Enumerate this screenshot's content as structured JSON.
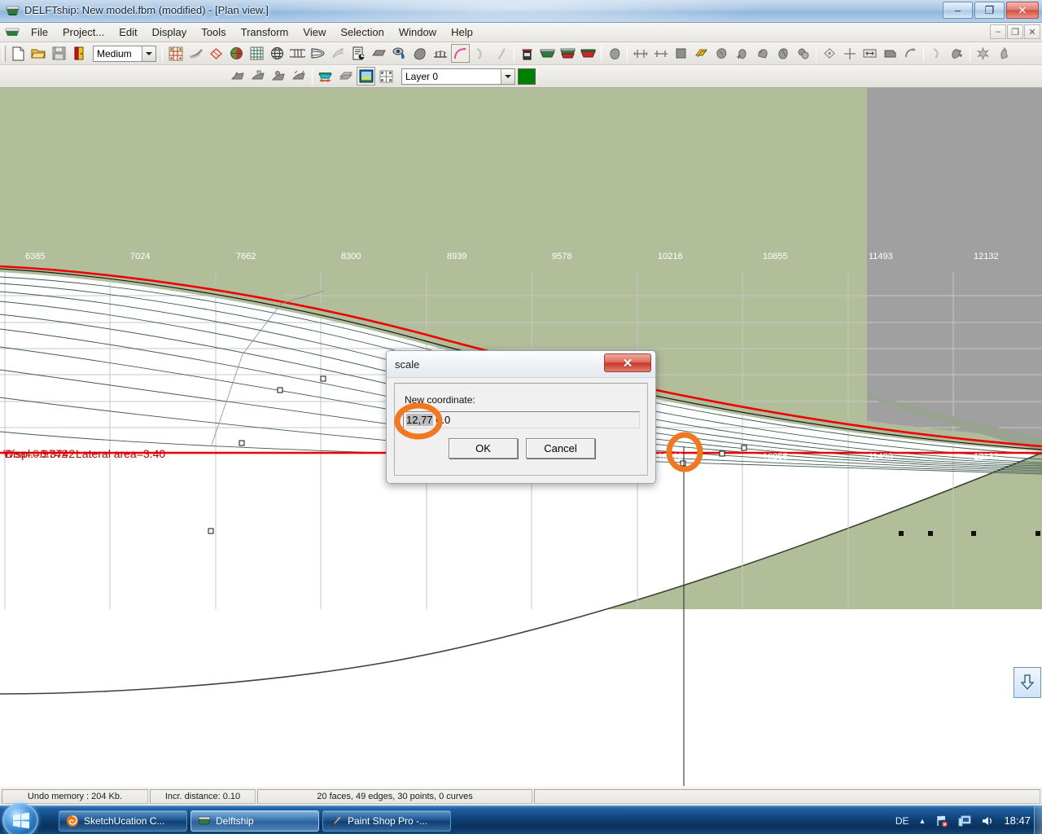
{
  "window": {
    "title": "DELFTship: New model.fbm (modified) - [Plan view.]",
    "minimize": "–",
    "restore": "❐",
    "close": "✕"
  },
  "mdi": {
    "minimize": "–",
    "restore": "❐",
    "close": "✕"
  },
  "menu": {
    "items": [
      {
        "label": "File"
      },
      {
        "label": "Project..."
      },
      {
        "label": "Edit"
      },
      {
        "label": "Display"
      },
      {
        "label": "Tools"
      },
      {
        "label": "Transform"
      },
      {
        "label": "View"
      },
      {
        "label": "Selection"
      },
      {
        "label": "Window"
      },
      {
        "label": "Help"
      }
    ]
  },
  "toolbar": {
    "precision_value": "Medium",
    "icons_row1": [
      "new-file-icon",
      "open-folder-icon",
      "save-icon",
      "exit-door-icon",
      "precision-combo",
      "checker-grid-icon",
      "hull-curve-icon",
      "diamond-outline-icon",
      "sphere-shade-icon",
      "grid-lines-icon",
      "render-globe-icon",
      "hull-sections-icon",
      "waterlines-icon",
      "wireframe-icon",
      "report-icon",
      "flat-plate-icon",
      "drop-eye-icon",
      "shape-fill-icon",
      "stations-icon",
      "curvature-icon",
      "spline1-icon",
      "spline2-icon",
      "tank-icon",
      "hull-green-icon",
      "hull-layers-icon",
      "hull-red-icon",
      "rock-gray-icon",
      "intersect-icon",
      "distance-icon",
      "square-icon",
      "color-plane-icon",
      "rock2-icon",
      "add-point-icon",
      "shape-a-icon",
      "shape-b-icon",
      "shape-c-icon",
      "shape-d-icon",
      "rotate-diamond-icon",
      "crosshair-icon",
      "collapse-icon",
      "extrude-icon",
      "flip-icon",
      "curve-small-icon",
      "points-icon",
      "explode-icon",
      "rooster-icon"
    ],
    "icons_row2": [
      "hull-gray-1-icon",
      "hull-gray-2-icon",
      "hull-gray-3-icon",
      "hull-gray-4-icon",
      "render-colored-icon",
      "layers-icon",
      "shaded-view-icon",
      "wire-corners-icon"
    ],
    "layer_value": "Layer 0",
    "layer_color": "#008000"
  },
  "canvas": {
    "bg_white": "#ffffff",
    "bg_green": "#b2bd9a",
    "bg_gray": "#a0a0a0",
    "hull_line_color": "#ff0000",
    "grid_color": "#bfbfbf",
    "top_ruler_labels": [
      "6385",
      "7024",
      "7662",
      "8300",
      "8939",
      "9578",
      "10216",
      "10855",
      "11493",
      "12132"
    ],
    "bottom_ruler_labels": [
      "10216",
      "10855",
      "11493",
      "12132"
    ],
    "hud_overlay": "Displ.=0.3742  Lateral area=3.40",
    "hud_text_a": "Displ.=0.3742",
    "hud_text_b": "Lateral area=3.40",
    "hud_text_c": "Wsa=0.9742",
    "scroll_down_icon": "arrow-down-icon"
  },
  "dialog": {
    "title": "scale",
    "close_label": "✕",
    "field_label": "New coordinate:",
    "input_value_selected": "12,77",
    "input_value_rest": " 0.0",
    "input_full_value": "12,77 0.0",
    "ok_label": "OK",
    "cancel_label": "Cancel"
  },
  "statusbar": {
    "cells": [
      {
        "text": "Undo memory : 204 Kb."
      },
      {
        "text": "Incr. distance: 0.10"
      },
      {
        "text": "20 faces, 49 edges, 30 points, 0 curves"
      }
    ]
  },
  "taskbar": {
    "start_label": "Start",
    "tasks": [
      {
        "label": "SketchUcation C...",
        "icon": "firefox-icon",
        "active": false
      },
      {
        "label": "Delftship",
        "icon": "delftship-icon",
        "active": true
      },
      {
        "label": "Paint Shop Pro -...",
        "icon": "paintshop-icon",
        "active": false
      }
    ],
    "tray": {
      "language": "DE",
      "chevron": "▲",
      "network_icon": "network-error-icon",
      "monitor_icon": "monitor-icon",
      "volume_icon": "speaker-icon",
      "clock": "18:47"
    }
  },
  "annotations": {
    "circle_color": "#f07820",
    "circle_input": "highlight-input-circle",
    "circle_point": "highlight-point-circle"
  }
}
